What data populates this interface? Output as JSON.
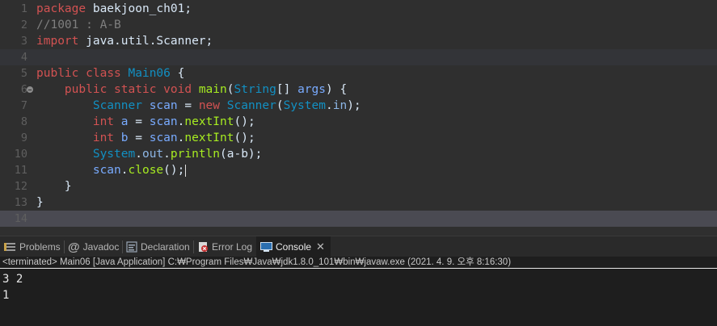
{
  "editor": {
    "line_numbers": [
      "1",
      "2",
      "3",
      "4",
      "5",
      "6",
      "7",
      "8",
      "9",
      "10",
      "11",
      "12",
      "13",
      "14"
    ],
    "lines": [
      [
        {
          "t": "package",
          "c": "kw"
        },
        {
          "t": " baekjoon_ch01;",
          "c": "pl"
        }
      ],
      [
        {
          "t": "//1001 : A-B",
          "c": "cm"
        }
      ],
      [
        {
          "t": "import",
          "c": "kw"
        },
        {
          "t": " java.util.Scanner;",
          "c": "pl"
        }
      ],
      [],
      [
        {
          "t": "public",
          "c": "kw"
        },
        {
          "t": " ",
          "c": "pl"
        },
        {
          "t": "class",
          "c": "kw"
        },
        {
          "t": " ",
          "c": "pl"
        },
        {
          "t": "Main06",
          "c": "ty"
        },
        {
          "t": " {",
          "c": "pl"
        }
      ],
      [
        {
          "t": "    ",
          "c": "pl"
        },
        {
          "t": "public",
          "c": "kw"
        },
        {
          "t": " ",
          "c": "pl"
        },
        {
          "t": "static",
          "c": "kw"
        },
        {
          "t": " ",
          "c": "pl"
        },
        {
          "t": "void",
          "c": "kw"
        },
        {
          "t": " ",
          "c": "pl"
        },
        {
          "t": "main",
          "c": "fn"
        },
        {
          "t": "(",
          "c": "pl"
        },
        {
          "t": "String",
          "c": "ty"
        },
        {
          "t": "[] ",
          "c": "pl"
        },
        {
          "t": "args",
          "c": "vr"
        },
        {
          "t": ") {",
          "c": "pl"
        }
      ],
      [
        {
          "t": "        ",
          "c": "pl"
        },
        {
          "t": "Scanner",
          "c": "ty"
        },
        {
          "t": " ",
          "c": "pl"
        },
        {
          "t": "scan",
          "c": "vr"
        },
        {
          "t": " = ",
          "c": "pl"
        },
        {
          "t": "new",
          "c": "kw"
        },
        {
          "t": " ",
          "c": "pl"
        },
        {
          "t": "Scanner",
          "c": "ty"
        },
        {
          "t": "(",
          "c": "pl"
        },
        {
          "t": "System",
          "c": "ty"
        },
        {
          "t": ".",
          "c": "pl"
        },
        {
          "t": "in",
          "c": "fd"
        },
        {
          "t": ");",
          "c": "pl"
        }
      ],
      [
        {
          "t": "        ",
          "c": "pl"
        },
        {
          "t": "int",
          "c": "kw"
        },
        {
          "t": " ",
          "c": "pl"
        },
        {
          "t": "a",
          "c": "vr"
        },
        {
          "t": " = ",
          "c": "pl"
        },
        {
          "t": "scan",
          "c": "vr"
        },
        {
          "t": ".",
          "c": "pl"
        },
        {
          "t": "nextInt",
          "c": "fn"
        },
        {
          "t": "();",
          "c": "pl"
        }
      ],
      [
        {
          "t": "        ",
          "c": "pl"
        },
        {
          "t": "int",
          "c": "kw"
        },
        {
          "t": " ",
          "c": "pl"
        },
        {
          "t": "b",
          "c": "vr"
        },
        {
          "t": " = ",
          "c": "pl"
        },
        {
          "t": "scan",
          "c": "vr"
        },
        {
          "t": ".",
          "c": "pl"
        },
        {
          "t": "nextInt",
          "c": "fn"
        },
        {
          "t": "();",
          "c": "pl"
        }
      ],
      [
        {
          "t": "        ",
          "c": "pl"
        },
        {
          "t": "System",
          "c": "ty"
        },
        {
          "t": ".",
          "c": "pl"
        },
        {
          "t": "out",
          "c": "fd"
        },
        {
          "t": ".",
          "c": "pl"
        },
        {
          "t": "println",
          "c": "fn"
        },
        {
          "t": "(a-b);",
          "c": "pl"
        }
      ],
      [
        {
          "t": "        ",
          "c": "pl"
        },
        {
          "t": "scan",
          "c": "vr"
        },
        {
          "t": ".",
          "c": "pl"
        },
        {
          "t": "close",
          "c": "fn"
        },
        {
          "t": "();",
          "c": "pl"
        }
      ],
      [
        {
          "t": "    }",
          "c": "pl"
        }
      ],
      [
        {
          "t": "}",
          "c": "pl"
        }
      ],
      []
    ]
  },
  "view_tabs": {
    "problems": "Problems",
    "javadoc": "Javadoc",
    "declaration": "Declaration",
    "error_log": "Error Log",
    "console": "Console",
    "close": "✕"
  },
  "console": {
    "status": "<terminated> Main06 [Java Application] C:₩Program Files₩Java₩jdk1.8.0_101₩bin₩javaw.exe (2021. 4. 9. 오후 8:16:30)",
    "output_line_1": "3 2",
    "output_line_2": "1"
  },
  "colors": {
    "keyword": "#d25252",
    "comment": "#7f7f7f",
    "type": "#1290c3",
    "method": "#a7ec21",
    "variable": "#79abff",
    "background": "#2f2f2f"
  }
}
